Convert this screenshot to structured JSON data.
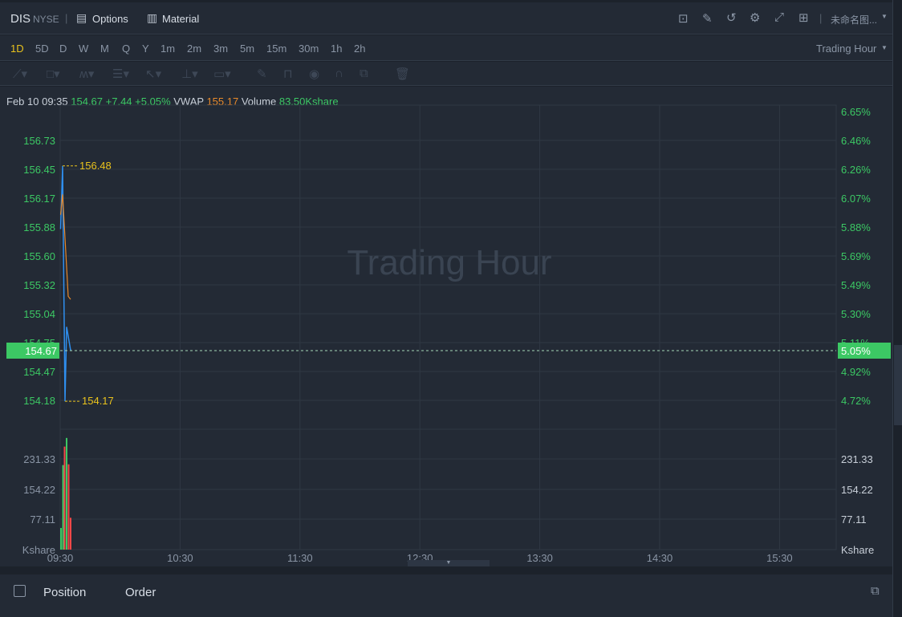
{
  "header": {
    "symbol": "DIS",
    "exchange": "NYSE",
    "options_label": "Options",
    "material_label": "Material",
    "layout_name": "未命名图...",
    "icons": [
      "indicator-icon",
      "draw-icon",
      "refresh-icon",
      "settings-icon",
      "fullscreen-icon",
      "grid-layout-icon"
    ]
  },
  "timeframes": {
    "items": [
      "1D",
      "5D",
      "D",
      "W",
      "M",
      "Q",
      "Y",
      "1m",
      "2m",
      "3m",
      "5m",
      "15m",
      "30m",
      "1h",
      "2h"
    ],
    "active": "1D",
    "session_label": "Trading Hour"
  },
  "info": {
    "datetime": "Feb 10 09:35",
    "price": "154.67",
    "change": "+7.44",
    "change_pct": "+5.05%",
    "vwap_label": "VWAP",
    "vwap": "155.17",
    "volume_label": "Volume",
    "volume": "83.50Kshare"
  },
  "watermark": "Trading Hour",
  "colors": {
    "up": "#3cc864",
    "down": "#f04848",
    "price_line": "#2f8fef",
    "vwap_line": "#e8892a",
    "accent": "#e9c21c"
  },
  "chart_data": {
    "type": "line",
    "price_axis": {
      "left": [
        "156.73",
        "156.45",
        "156.17",
        "155.88",
        "155.60",
        "155.32",
        "155.04",
        "154.75",
        "154.47",
        "154.18"
      ],
      "right": [
        "6.65%",
        "6.46%",
        "6.26%",
        "6.07%",
        "5.88%",
        "5.69%",
        "5.49%",
        "5.30%",
        "5.11%",
        "4.92%",
        "4.72%"
      ]
    },
    "current": {
      "price": "154.67",
      "pct": "5.05%"
    },
    "high_label": "156.48",
    "low_label": "154.17",
    "price": [
      155.86,
      156.48,
      154.17,
      154.9,
      154.67
    ],
    "vwap": [
      156.0,
      156.2,
      155.2,
      155.17
    ],
    "volume_axis": [
      "231.33",
      "154.22",
      "77.11"
    ],
    "volume_unit": "Kshare",
    "volume": [
      {
        "v": 55,
        "dir": "up"
      },
      {
        "v": 215,
        "dir": "up"
      },
      {
        "v": 262,
        "dir": "down"
      },
      {
        "v": 284,
        "dir": "up"
      },
      {
        "v": 217,
        "dir": "down"
      },
      {
        "v": 81,
        "dir": "down"
      }
    ],
    "time_axis": [
      "09:30",
      "10:30",
      "11:30",
      "12:30",
      "13:30",
      "14:30",
      "15:30"
    ]
  },
  "bottom": {
    "tabs": [
      "Position",
      "Order"
    ]
  }
}
